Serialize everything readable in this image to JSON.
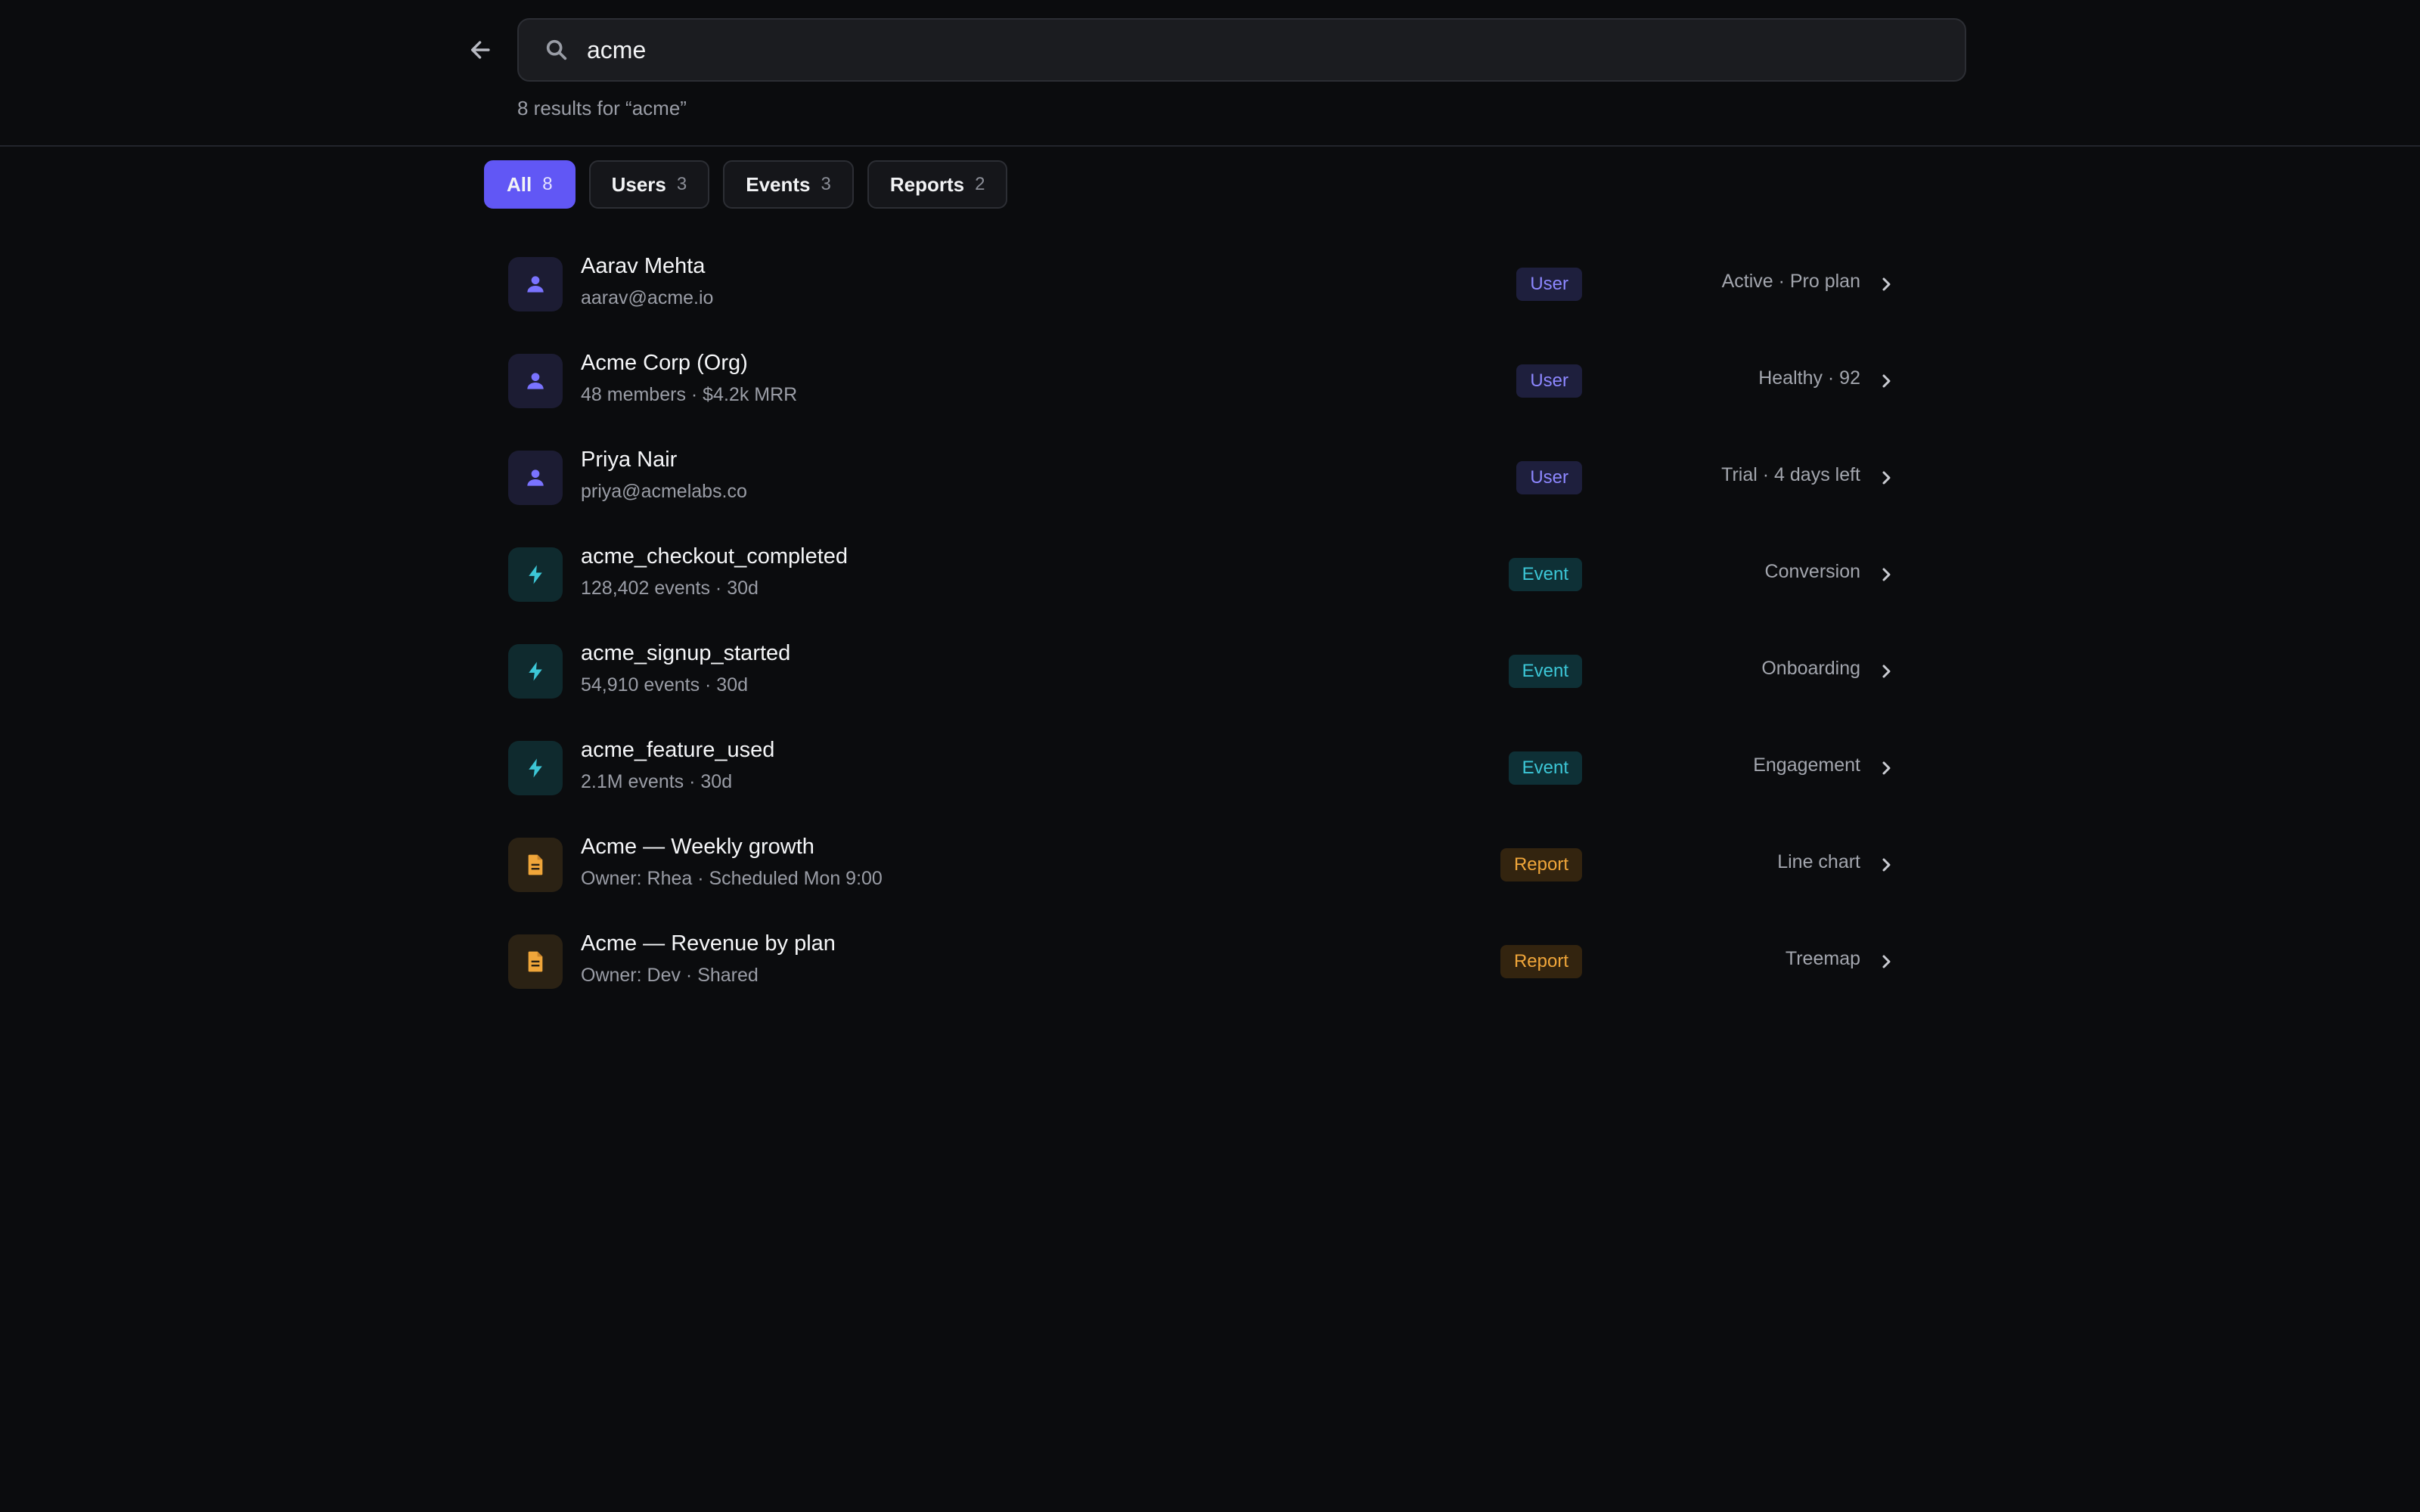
{
  "search": {
    "value": "acme",
    "result_count_text": "8 results for “acme”"
  },
  "filters": [
    {
      "label": "All",
      "count": "8",
      "active": true
    },
    {
      "label": "Users",
      "count": "3",
      "active": false
    },
    {
      "label": "Events",
      "count": "3",
      "active": false
    },
    {
      "label": "Reports",
      "count": "2",
      "active": false
    }
  ],
  "results": [
    {
      "title": "Aarav Mehta",
      "sub": "aarav@acme.io",
      "badge": "User",
      "meta": "Active · Pro plan",
      "kind": "user",
      "icon": "person-icon"
    },
    {
      "title": "Acme Corp (Org)",
      "sub": "48 members · $4.2k MRR",
      "badge": "User",
      "meta": "Healthy · 92",
      "kind": "user",
      "icon": "person-icon"
    },
    {
      "title": "Priya Nair",
      "sub": "priya@acmelabs.co",
      "badge": "User",
      "meta": "Trial · 4 days left",
      "kind": "user",
      "icon": "person-icon"
    },
    {
      "title": "acme_checkout_completed",
      "sub": "128,402 events · 30d",
      "badge": "Event",
      "meta": "Conversion",
      "kind": "event",
      "icon": "lightning-bolt-icon"
    },
    {
      "title": "acme_signup_started",
      "sub": "54,910 events · 30d",
      "badge": "Event",
      "meta": "Onboarding",
      "kind": "event",
      "icon": "lightning-bolt-icon"
    },
    {
      "title": "acme_feature_used",
      "sub": "2.1M events · 30d",
      "badge": "Event",
      "meta": "Engagement",
      "kind": "event",
      "icon": "lightning-bolt-icon"
    },
    {
      "title": "Acme — Weekly growth",
      "sub": "Owner: Rhea · Scheduled Mon 9:00",
      "badge": "Report",
      "meta": "Line chart",
      "kind": "report",
      "icon": "document-icon"
    },
    {
      "title": "Acme — Revenue by plan",
      "sub": "Owner: Dev · Shared",
      "badge": "Report",
      "meta": "Treemap",
      "kind": "report",
      "icon": "document-icon"
    }
  ],
  "colors": {
    "background": "#0b0c0e",
    "accent": "#6157f5",
    "user": "#7a73ff",
    "event": "#3cc6d6",
    "report": "#f0a63a"
  }
}
